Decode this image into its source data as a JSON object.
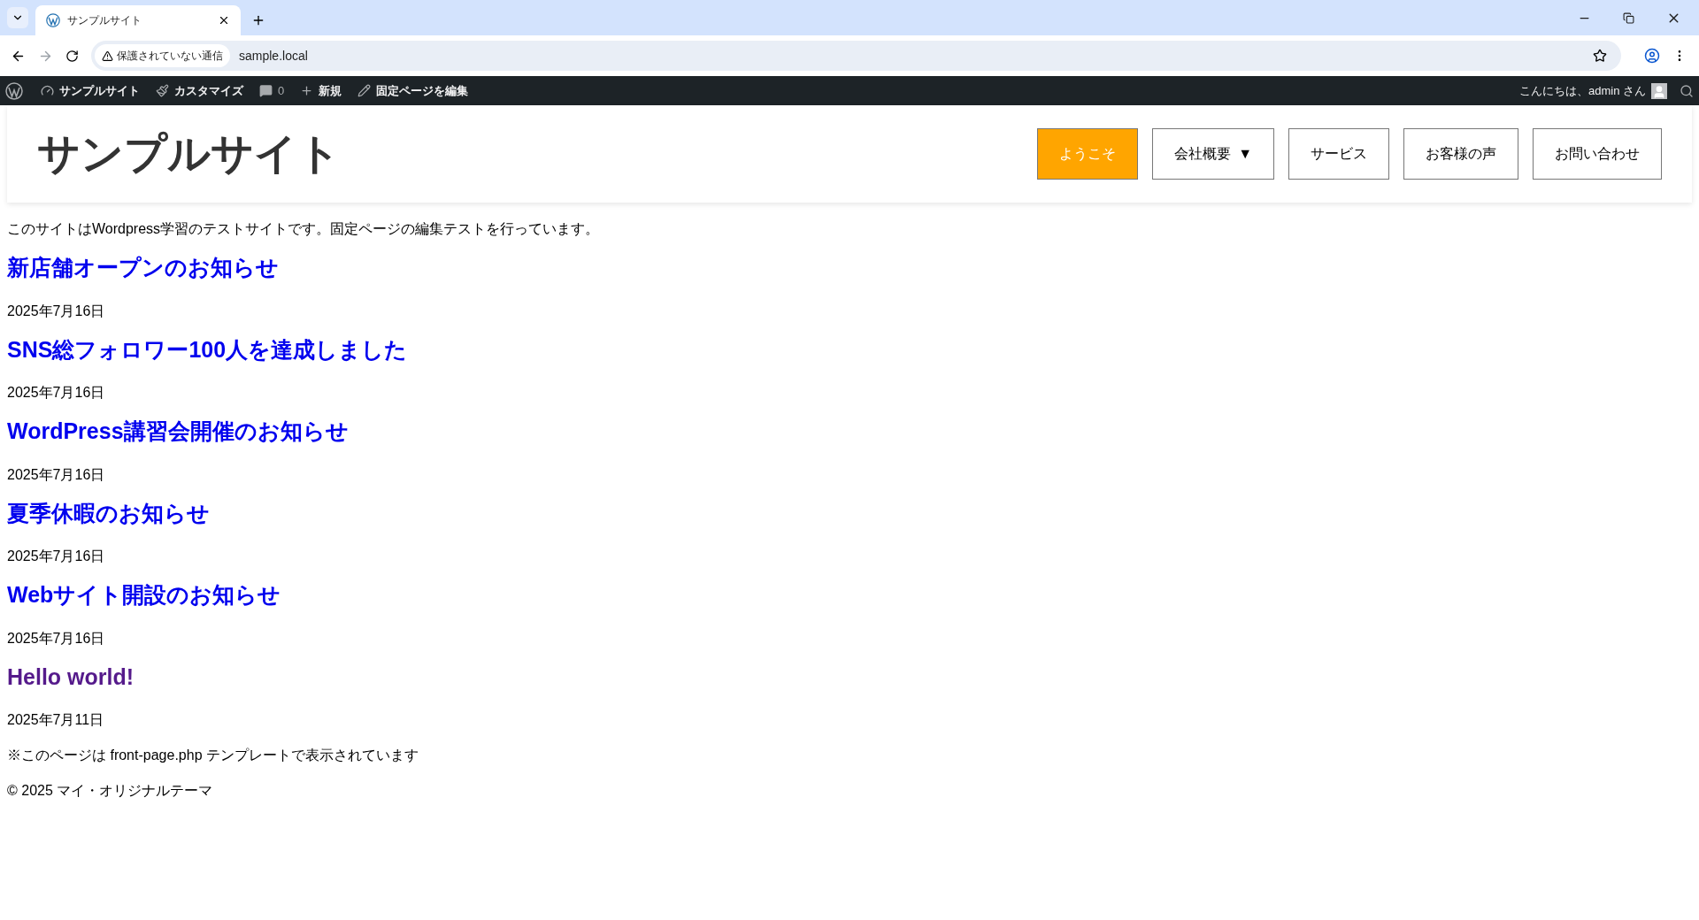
{
  "browser": {
    "tab_title": "サンプルサイト",
    "security_label": "保護されていない通信",
    "url": "sample.local"
  },
  "admin_bar": {
    "items": [
      {
        "kind": "site",
        "label": "サンプルサイト"
      },
      {
        "kind": "customize",
        "label": "カスタマイズ"
      },
      {
        "kind": "comments",
        "label": "0"
      },
      {
        "kind": "new",
        "label": "新規"
      },
      {
        "kind": "edit",
        "label": "固定ページを編集"
      }
    ],
    "greeting": "こんにちは、admin さん"
  },
  "header": {
    "site_title": "サンプルサイト",
    "nav": [
      {
        "label": "ようこそ",
        "selected": true
      },
      {
        "label": "会社概要",
        "selected": false,
        "caret": "▼"
      },
      {
        "label": "サービス",
        "selected": false
      },
      {
        "label": "お客様の声",
        "selected": false
      },
      {
        "label": "お問い合わせ",
        "selected": false
      }
    ]
  },
  "intro": "このサイトはWordpress学習のテストサイトです。固定ページの編集テストを行っています。",
  "posts": [
    {
      "title": "新店舗オープンのお知らせ",
      "date": "2025年7月16日",
      "visited": false
    },
    {
      "title": "SNS総フォロワー100人を達成しました",
      "date": "2025年7月16日",
      "visited": false
    },
    {
      "title": "WordPress講習会開催のお知らせ",
      "date": "2025年7月16日",
      "visited": false
    },
    {
      "title": "夏季休暇のお知らせ",
      "date": "2025年7月16日",
      "visited": false
    },
    {
      "title": "Webサイト開設のお知らせ",
      "date": "2025年7月16日",
      "visited": false
    },
    {
      "title": "Hello world!",
      "date": "2025年7月11日",
      "visited": true
    }
  ],
  "template_note": "※このページは front-page.php テンプレートで表示されています",
  "footer": "© 2025 マイ・オリジナルテーマ"
}
